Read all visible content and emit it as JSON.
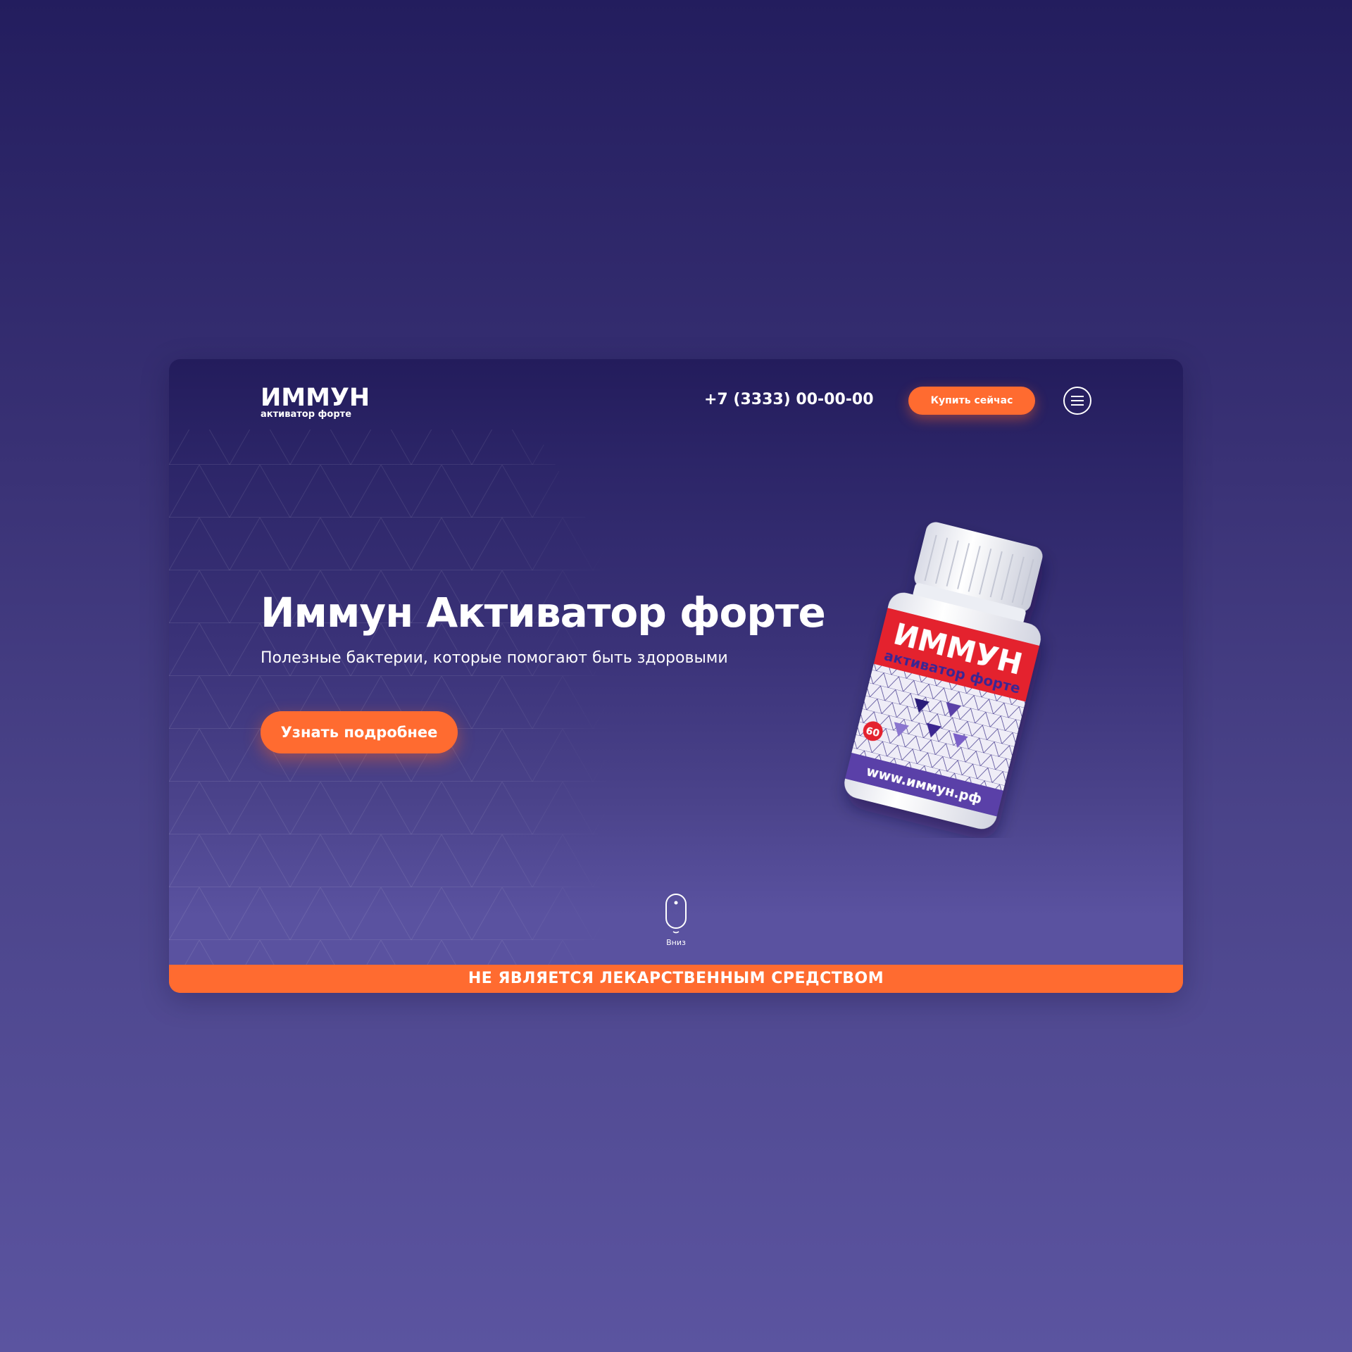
{
  "header": {
    "logo_main": "ИММУН",
    "logo_sub": "активатор форте",
    "phone": "+7 (3333) 00-00-00",
    "buy_button": "Купить сейчас",
    "menu_icon": "hamburger-menu-icon"
  },
  "hero": {
    "title": "Иммун Активатор форте",
    "subtitle": "Полезные бактерии, которые помогают быть здоровыми",
    "cta_button": "Узнать подробнее"
  },
  "product": {
    "label_main": "ИММУН",
    "label_sub": "активатор форте",
    "count": "60",
    "website": "www.иммун.рф"
  },
  "scroll": {
    "label": "Вниз",
    "icon": "mouse-icon"
  },
  "footer": {
    "disclaimer": "НЕ ЯВЛЯЕТСЯ ЛЕКАРСТВЕННЫМ СРЕДСТВОМ"
  },
  "colors": {
    "accent": "#ff6b30",
    "background_top": "#231d5e",
    "background_bottom": "#5b54a0",
    "bottle_label_red": "#e4212f",
    "bottle_label_purple": "#5a3fa8"
  }
}
